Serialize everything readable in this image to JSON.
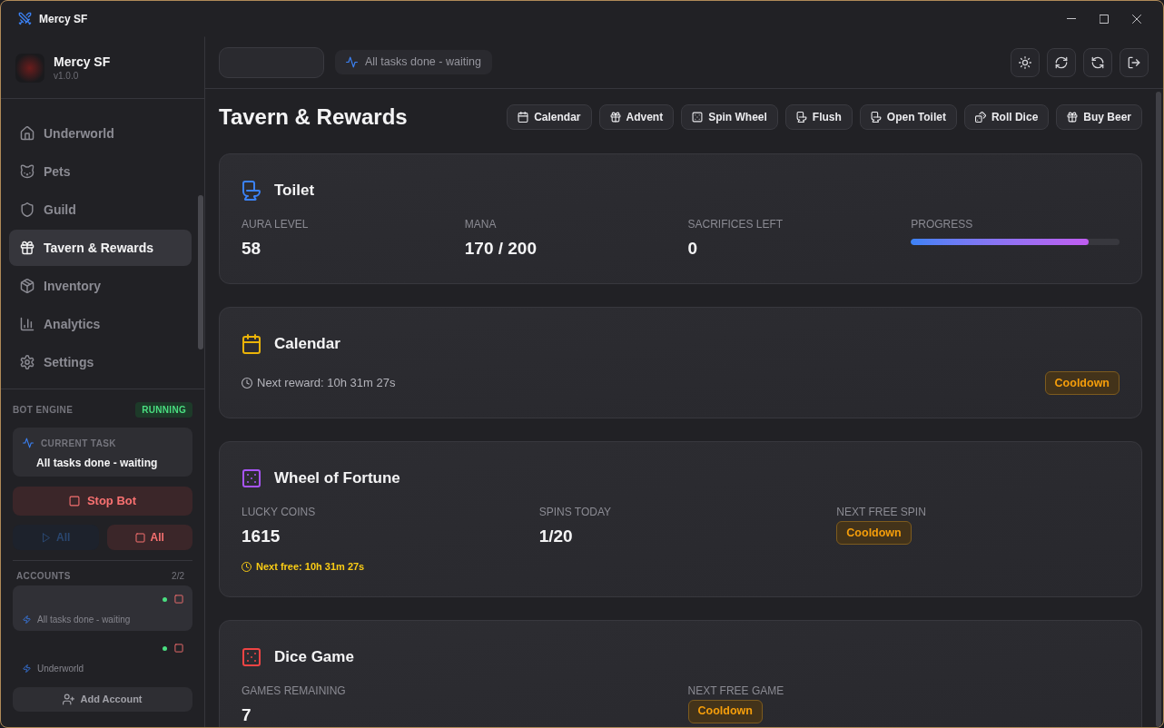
{
  "window": {
    "title": "Mercy SF"
  },
  "sidebar": {
    "app": {
      "name": "Mercy SF",
      "version": "v1.0.0"
    },
    "nav": [
      {
        "label": "Underworld",
        "selected": false
      },
      {
        "label": "Pets",
        "selected": false
      },
      {
        "label": "Guild",
        "selected": false
      },
      {
        "label": "Tavern & Rewards",
        "selected": true
      },
      {
        "label": "Inventory",
        "selected": false
      },
      {
        "label": "Analytics",
        "selected": false
      },
      {
        "label": "Settings",
        "selected": false
      }
    ],
    "bot_engine": {
      "label": "BOT ENGINE",
      "status": "RUNNING",
      "current_task": {
        "label": "CURRENT TASK",
        "value": "All tasks done - waiting"
      },
      "stop_button": "Stop Bot",
      "start_all": {
        "label": "All",
        "disabled": true
      },
      "stop_all": {
        "label": "All",
        "disabled": false
      }
    },
    "accounts": {
      "label": "ACCOUNTS",
      "count": "2/2",
      "items": [
        {
          "status": "All tasks done - waiting",
          "online": true,
          "selected": true
        },
        {
          "status": "Underworld",
          "online": true,
          "selected": false
        }
      ]
    },
    "add_account_button": "Add Account"
  },
  "top_bar": {
    "status": "All tasks done - waiting"
  },
  "page": {
    "title": "Tavern & Rewards",
    "actions": [
      "Calendar",
      "Advent",
      "Spin Wheel",
      "Flush",
      "Open Toilet",
      "Roll Dice",
      "Buy Beer"
    ]
  },
  "cards": [
    {
      "kind": "stats",
      "title": "Toilet",
      "color": "#3b82f6",
      "stats": [
        {
          "kind": "value",
          "label": "AURA LEVEL",
          "value": "58"
        },
        {
          "kind": "value",
          "label": "MANA",
          "value": "170 / 200"
        },
        {
          "kind": "value",
          "label": "SACRIFICES LEFT",
          "value": "0"
        },
        {
          "kind": "progress",
          "label": "PROGRESS",
          "level": 0.85
        }
      ]
    },
    {
      "kind": "timer",
      "title": "Calendar",
      "color": "#eab308",
      "note": "Next reward: 10h 31m 27s",
      "badge": "Cooldown"
    },
    {
      "kind": "stats",
      "title": "Wheel of Fortune",
      "color": "#a855f7",
      "stats": [
        {
          "kind": "value",
          "label": "LUCKY COINS",
          "value": "1615"
        },
        {
          "kind": "value",
          "label": "SPINS TODAY",
          "value": "1/20"
        },
        {
          "kind": "badge",
          "label": "NEXT FREE SPIN",
          "value": "Cooldown"
        }
      ],
      "footnote": "Next free: 10h 31m 27s"
    },
    {
      "kind": "stats",
      "title": "Dice Game",
      "color": "#ef4444",
      "stats": [
        {
          "kind": "value",
          "label": "GAMES REMAINING",
          "value": "7"
        },
        {
          "kind": "badge",
          "label": "NEXT FREE GAME",
          "value": "Cooldown"
        }
      ]
    }
  ]
}
